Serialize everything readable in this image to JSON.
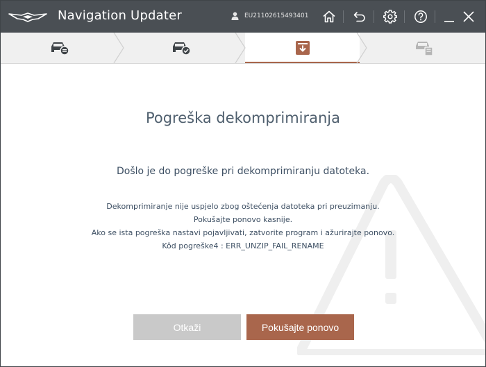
{
  "app": {
    "title": "Navigation Updater",
    "user_id": "EU21102615493401"
  },
  "titlebar": {
    "icons": [
      "home-icon",
      "back-icon",
      "gear-icon",
      "help-icon",
      "minimize-icon",
      "close-icon"
    ]
  },
  "steps": [
    {
      "icon": "car-list-icon",
      "state": "done"
    },
    {
      "icon": "car-check-icon",
      "state": "done"
    },
    {
      "icon": "download-icon",
      "state": "active"
    },
    {
      "icon": "car-update-icon",
      "state": "pending"
    }
  ],
  "colors": {
    "titlebar": "#4a4f54",
    "accent": "#a9664c",
    "cancel": "#c9c9c9"
  },
  "dialog": {
    "title": "Pogreška dekomprimiranja",
    "subtitle": "Došlo je do pogreške pri dekomprimiranju datoteka.",
    "lines": [
      "Dekomprimiranje nije uspjelo zbog oštećenja datoteka pri preuzimanju.",
      "Pokušajte ponovo kasnije.",
      "Ako se ista pogreška nastavi pojavljivati, zatvorite program i ažurirajte ponovo.",
      "Kôd pogreške4 : ERR_UNZIP_FAIL_RENAME"
    ],
    "cancel_label": "Otkaži",
    "retry_label": "Pokušajte ponovo"
  }
}
